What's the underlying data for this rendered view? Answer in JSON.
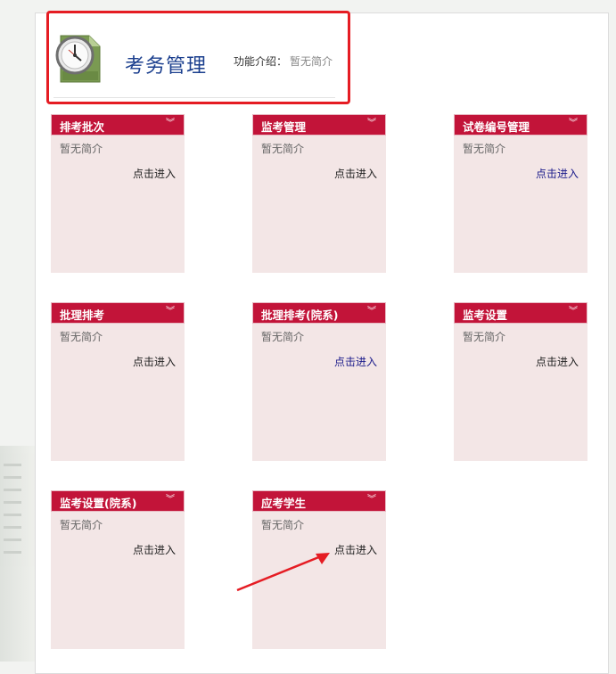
{
  "header": {
    "title": "考务管理",
    "intro_label": "功能介绍：",
    "intro_value": "暂无简介"
  },
  "modules": [
    {
      "title": "排考批次",
      "desc": "暂无简介",
      "link": "点击进入"
    },
    {
      "title": "监考管理",
      "desc": "暂无简介",
      "link": "点击进入"
    },
    {
      "title": "试卷编号管理",
      "desc": "暂无简介",
      "link": "点击进入"
    },
    {
      "title": "批理排考",
      "desc": "暂无简介",
      "link": "点击进入"
    },
    {
      "title": "批理排考(院系)",
      "desc": "暂无简介",
      "link": "点击进入"
    },
    {
      "title": "监考设置",
      "desc": "暂无简介",
      "link": "点击进入"
    },
    {
      "title": "监考设置(院系)",
      "desc": "暂无简介",
      "link": "点击进入"
    },
    {
      "title": "应考学生",
      "desc": "暂无简介",
      "link": "点击进入"
    }
  ],
  "colors": {
    "card_header": "#c21439",
    "card_body": "#f3e6e6",
    "highlight_border": "#e51c23",
    "annotation_arrow": "#e51c23",
    "title_text": "#1b3f8e"
  },
  "icons": {
    "header": "clock-icon",
    "card_toggle": "chevron-double-down-icon",
    "annotation": "red-arrow-icon"
  }
}
